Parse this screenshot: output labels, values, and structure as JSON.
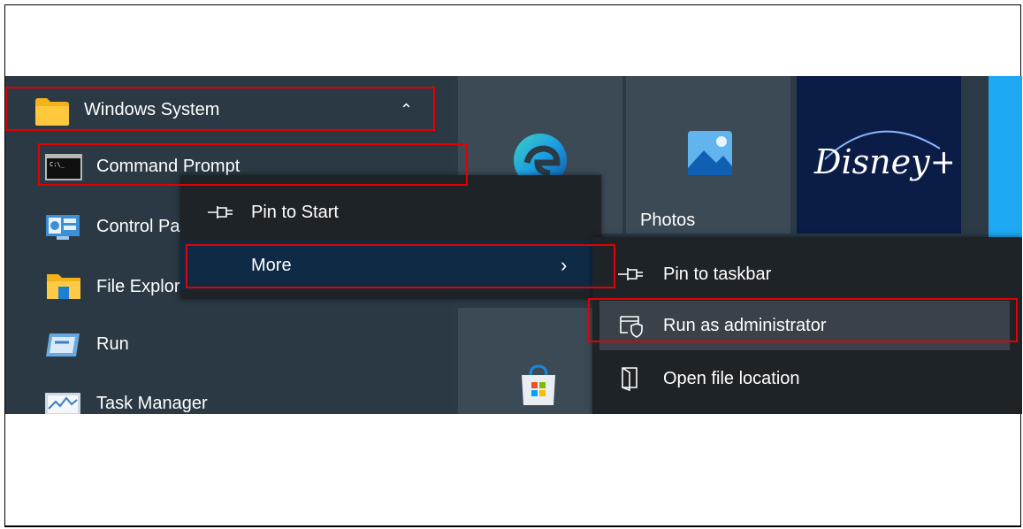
{
  "start_menu": {
    "group": {
      "label": "Windows System",
      "toggle_glyph": "⌃",
      "icon": "folder-icon"
    },
    "items": [
      {
        "label": "Command Prompt",
        "icon": "command-prompt-icon"
      },
      {
        "label": "Control Pa",
        "icon": "control-panel-icon"
      },
      {
        "label": "File Explor",
        "icon": "file-explorer-icon"
      },
      {
        "label": "Run",
        "icon": "run-icon"
      },
      {
        "label": "Task Manager",
        "icon": "task-manager-icon"
      }
    ]
  },
  "tiles": {
    "photos_label": "Photos",
    "disney_logo_text": "Disney+"
  },
  "context_menu": {
    "items": [
      {
        "label": "Pin to Start",
        "icon": "pin-icon"
      },
      {
        "label": "More",
        "icon": "chevron-right-icon",
        "chevron": "›"
      }
    ]
  },
  "submenu": {
    "items": [
      {
        "label": "Pin to taskbar",
        "icon": "pin-icon"
      },
      {
        "label": "Run as administrator",
        "icon": "run-as-admin-icon"
      },
      {
        "label": "Open file location",
        "icon": "file-location-icon"
      }
    ]
  },
  "colors": {
    "highlight_border": "#e30000",
    "menu_bg": "#1e2328",
    "list_bg": "#2a3943",
    "accent_blue": "#1ea7f3"
  }
}
